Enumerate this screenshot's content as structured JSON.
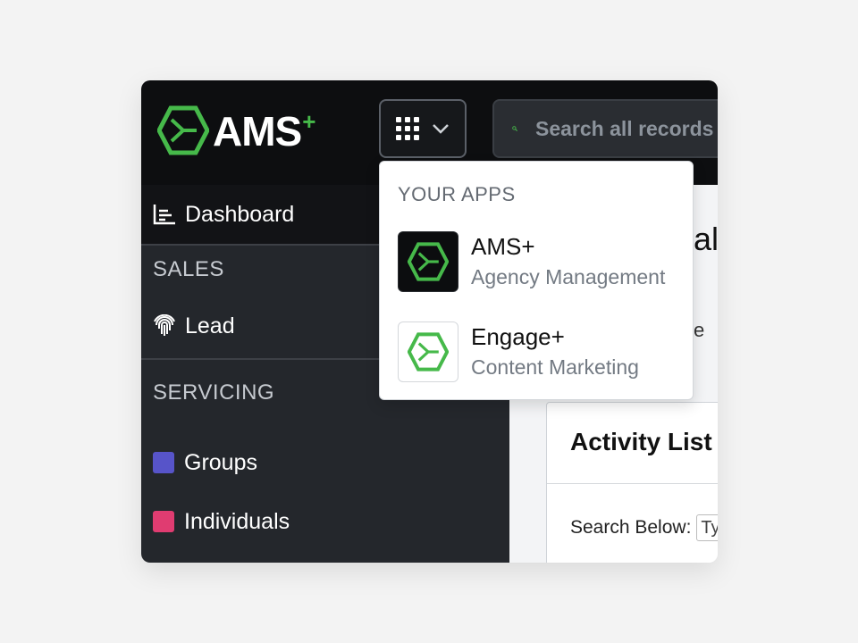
{
  "header": {
    "logo_text": "AMS",
    "logo_plus": "+",
    "apps_button_icon": "grid-9-dots-icon",
    "search_placeholder": "Search all records"
  },
  "sidebar": {
    "dashboard_label": "Dashboard",
    "sales_header": "SALES",
    "lead_label": "Lead",
    "servicing_header": "SERVICING",
    "groups_label": "Groups",
    "individuals_label": "Individuals",
    "groups_color": "#5754c9",
    "individuals_color": "#e03c71"
  },
  "main": {
    "title_partial": "al",
    "subtitle_partial": "tie",
    "card_title": "Activity List",
    "search_label": "Search Below:",
    "search_value": "Ty"
  },
  "apps_dropdown": {
    "header": "YOUR APPS",
    "apps": [
      {
        "name": "AMS+",
        "description": "Agency Management",
        "tile": "dark"
      },
      {
        "name": "Engage+",
        "description": "Content Marketing",
        "tile": "light"
      }
    ]
  },
  "colors": {
    "brand_green": "#46b94a",
    "topbar": "#0d0e10",
    "sidebar": "#24272c"
  }
}
